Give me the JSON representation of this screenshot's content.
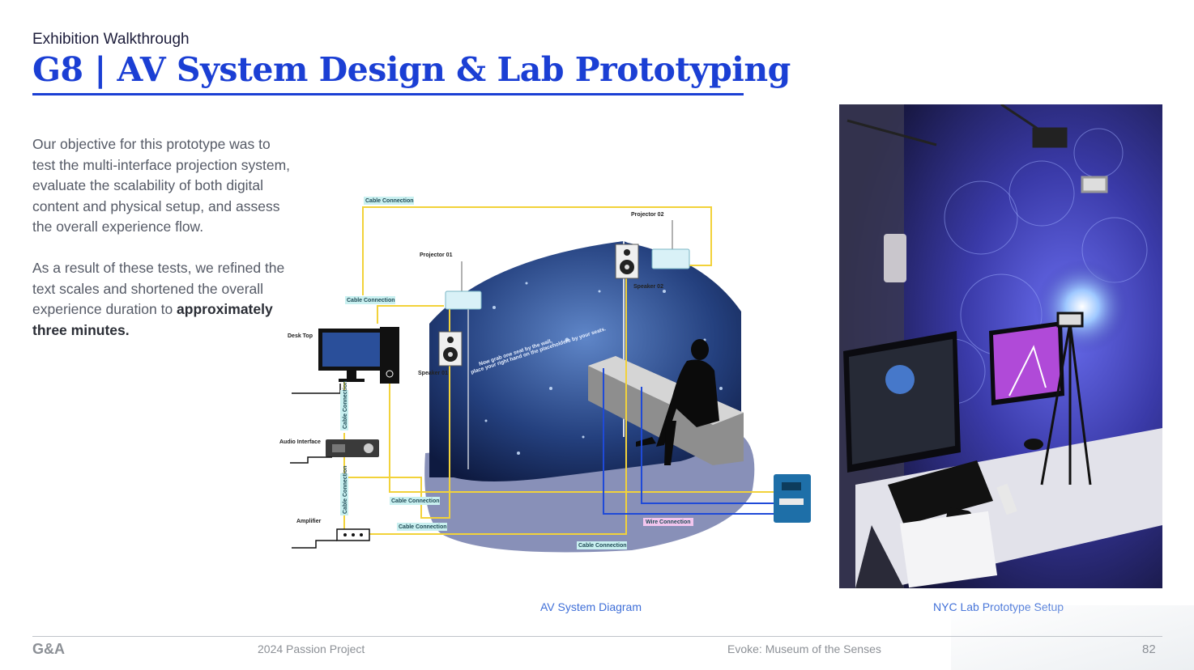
{
  "header": {
    "eyebrow": "Exhibition Walkthrough",
    "title": "G8 | AV System Design & Lab Prototyping"
  },
  "body": {
    "paragraph1": "Our objective for this prototype was to test the multi-interface projection system, evaluate the scalability of both digital content and physical setup, and assess the overall experience flow.",
    "paragraph2_lead": "As a result of these tests, we refined the text scales and shortened the overall experience duration to ",
    "paragraph2_bold": "approximately three minutes."
  },
  "diagram": {
    "labels": {
      "projector_01": "Projector 01",
      "projector_02": "Projector 02",
      "speaker_01": "Speaker 01",
      "speaker_02": "Speaker 02",
      "desk_top": "Desk Top",
      "audio_interface": "Audio Interface",
      "amplifier": "Amplifier",
      "cable_connection": "Cable Connection",
      "wire_connection": "Wire Connection",
      "projection_text_1": "Now grab one seat by the wall,",
      "projection_text_2": "place your right hand on the placeholders by your seats."
    },
    "colors": {
      "cable": "#f2d23a",
      "wire": "#1f4ad8",
      "cable_label_bg": "#c9f0f0",
      "wire_label_bg": "#f3c6ef",
      "floor": "#8890b8",
      "wall": "#1a2f66"
    }
  },
  "captions": {
    "diagram": "AV System Diagram",
    "photo": "NYC Lab Prototype Setup"
  },
  "footer": {
    "logo": "G&A",
    "project": "2024 Passion Project",
    "subtitle": "Evoke: Museum of the Senses",
    "page": "82"
  }
}
